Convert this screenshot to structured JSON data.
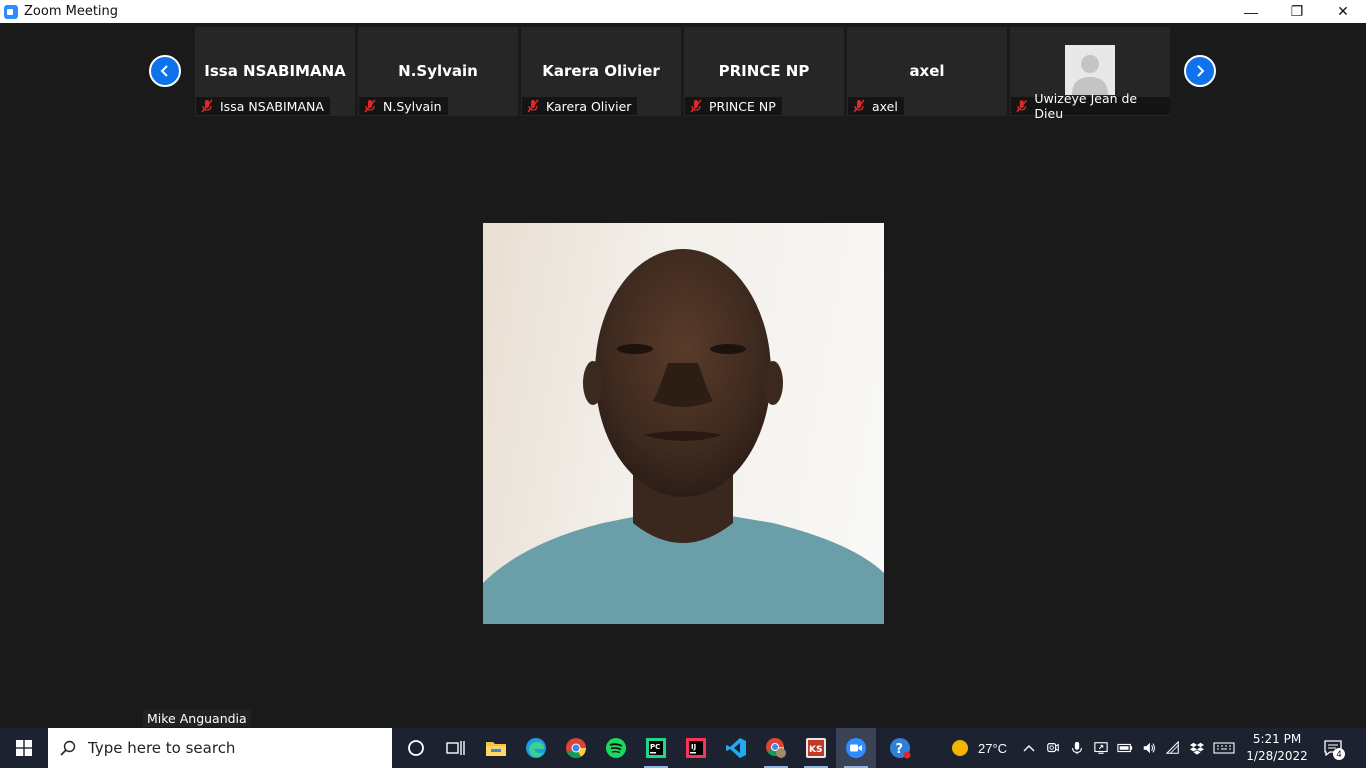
{
  "window": {
    "title": "Zoom Meeting",
    "minimize_glyph": "—",
    "restore_glyph": "❐",
    "close_glyph": "✕"
  },
  "meeting": {
    "participants": [
      {
        "display_name": "Issa NSABIMANA",
        "label": "Issa NSABIMANA",
        "muted": true,
        "video": false
      },
      {
        "display_name": "N.Sylvain",
        "label": "N.Sylvain",
        "muted": true,
        "video": false
      },
      {
        "display_name": "Karera Olivier",
        "label": "Karera Olivier",
        "muted": true,
        "video": false
      },
      {
        "display_name": "PRINCE NP",
        "label": "PRINCE NP",
        "muted": true,
        "video": false
      },
      {
        "display_name": "axel",
        "label": "axel",
        "muted": true,
        "video": false
      },
      {
        "display_name": "",
        "label": "Uwizeye Jean de Dieu",
        "muted": true,
        "video": false,
        "avatar": "default-avatar-icon"
      }
    ],
    "active_speaker": "Mike Anguandia"
  },
  "taskbar": {
    "search_placeholder": "Type here to search",
    "apps": [
      "cortana-icon",
      "task-view-icon",
      "file-explorer-icon",
      "edge-icon",
      "chrome-icon",
      "spotify-icon",
      "pycharm-icon",
      "intellij-icon",
      "vscode-icon",
      "chrome-profile-icon",
      "jetbrains-tool-icon",
      "zoom-icon",
      "help-icon"
    ],
    "weather": "27°C",
    "time": "5:21 PM",
    "date": "1/28/2022",
    "notification_count": "4"
  },
  "colors": {
    "accent": "#0e72ed",
    "muted_mic": "#e02828",
    "meeting_bg": "#1a1a1a",
    "taskbar_bg": "#1c2230"
  }
}
